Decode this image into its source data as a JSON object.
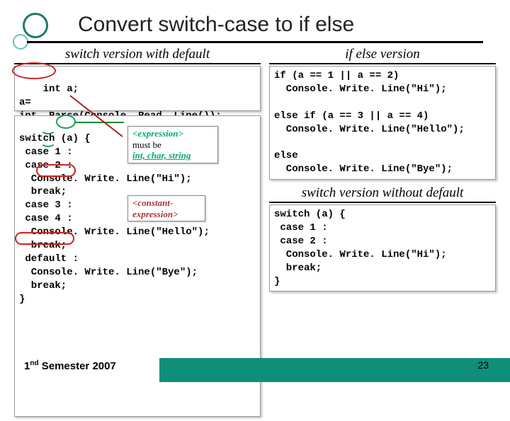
{
  "title": "Convert switch-case to if else",
  "left": {
    "heading": "switch version with default",
    "box1_line1": "int a;",
    "box1_line2": "a=",
    "box1_line3": "int. Parse(Console. Read. Line());",
    "box2": "switch (a) {\n case 1 :\n case 2 :\n  Console. Write. Line(\"Hi\");\n  break;\n case 3 :\n case 4 :\n  Console. Write. Line(\"Hello\");\n  break;\n default :\n  Console. Write. Line(\"Bye\");\n  break;\n}"
  },
  "annot1_l1": "<expression>",
  "annot1_l2": "must be",
  "annot1_l3": "int, char, string",
  "annot2_l1": "<constant-",
  "annot2_l2": "expression>",
  "right": {
    "heading1": "if else version",
    "box1": "if (a == 1 || a == 2)\n  Console. Write. Line(\"Hi\");\n\nelse if (a == 3 || a == 4)\n  Console. Write. Line(\"Hello\");\n\nelse\n  Console. Write. Line(\"Bye\");",
    "heading2": "switch version without default",
    "box2": "switch (a) {\n case 1 :\n case 2 :\n  Console. Write. Line(\"Hi\");\n  break;\n}"
  },
  "footer_left_a": "1",
  "footer_left_b": "nd",
  "footer_left_c": " Semester 200",
  "footer_left_d": "7",
  "page_num": "23"
}
